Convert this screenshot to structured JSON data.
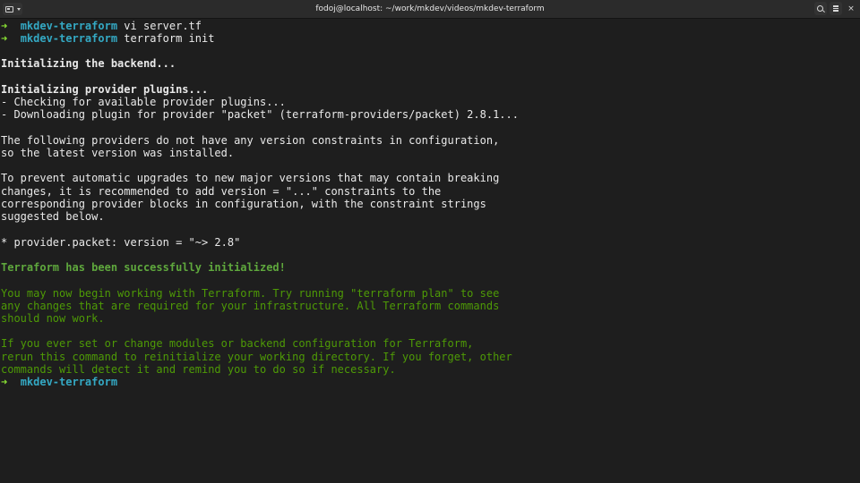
{
  "window": {
    "title": "fodoj@localhost: ~/work/mkdev/videos/mkdev-terraform",
    "icons": [
      "new-tab-icon",
      "chevron-down-icon",
      "search-icon",
      "menu-icon",
      "close-icon"
    ],
    "close_glyph": "×"
  },
  "colors": {
    "background": "#1e1e1e",
    "prompt_arrow": "#8ae234",
    "prompt_dir": "#34a9c4",
    "success": "#5fa83d",
    "info": "#4e9a06"
  },
  "terminal": {
    "prompt_arrow": "➜",
    "prompt_dir": "mkdev-terraform",
    "cmd1": "vi server.tf",
    "cmd2": "terraform init",
    "init_backend": "Initializing the backend...",
    "init_plugins": "Initializing provider plugins...",
    "checking": "- Checking for available provider plugins...",
    "downloading": "- Downloading plugin for provider \"packet\" (terraform-providers/packet) 2.8.1...",
    "no_constraints_1": "The following providers do not have any version constraints in configuration,",
    "no_constraints_2": "so the latest version was installed.",
    "prevent_1": "To prevent automatic upgrades to new major versions that may contain breaking",
    "prevent_2": "changes, it is recommended to add version = \"...\" constraints to the",
    "prevent_3": "corresponding provider blocks in configuration, with the constraint strings",
    "prevent_4": "suggested below.",
    "constraint": "* provider.packet: version = \"~> 2.8\"",
    "success": "Terraform has been successfully initialized!",
    "info_1": "You may now begin working with Terraform. Try running \"terraform plan\" to see",
    "info_2": "any changes that are required for your infrastructure. All Terraform commands",
    "info_3": "should now work.",
    "info_4": "If you ever set or change modules or backend configuration for Terraform,",
    "info_5": "rerun this command to reinitialize your working directory. If you forget, other",
    "info_6": "commands will detect it and remind you to do so if necessary."
  }
}
